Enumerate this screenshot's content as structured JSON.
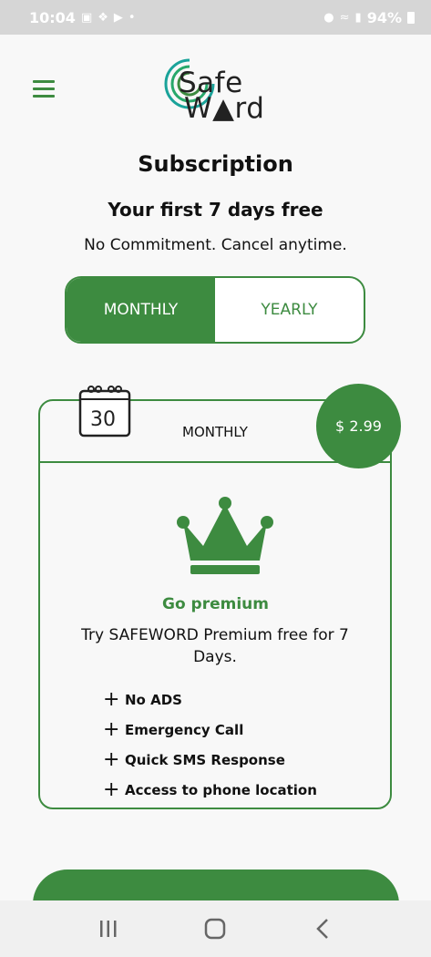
{
  "status_bar": {
    "time": "10:04",
    "battery": "94%",
    "left_icons": [
      "image-icon",
      "app-icon",
      "video-icon",
      "dot-icon"
    ],
    "right_icons": [
      "location-icon",
      "wifi-icon",
      "signal-icon",
      "battery-icon"
    ]
  },
  "header": {
    "logo_line1": "Safe",
    "logo_line2": "W▲rd",
    "menu_icon": "hamburger-menu-icon"
  },
  "page": {
    "title": "Subscription",
    "subtitle": "Your first 7 days free",
    "tagline": "No Commitment. Cancel anytime."
  },
  "toggle": {
    "options": [
      "MONTHLY",
      "YEARLY"
    ],
    "selected": "MONTHLY"
  },
  "plan_card": {
    "calendar_day": "30",
    "plan_name": "MONTHLY",
    "price": "$ 2.99",
    "premium_title": "Go premium",
    "description": "Try SAFEWORD Premium free for 7 Days.",
    "features": [
      "No ADS",
      "Emergency Call",
      "Quick SMS Response",
      "Access to phone location"
    ]
  },
  "colors": {
    "accent": "#3d8b40",
    "background": "#f8f8f8",
    "status_bar": "#d6d6d6"
  }
}
